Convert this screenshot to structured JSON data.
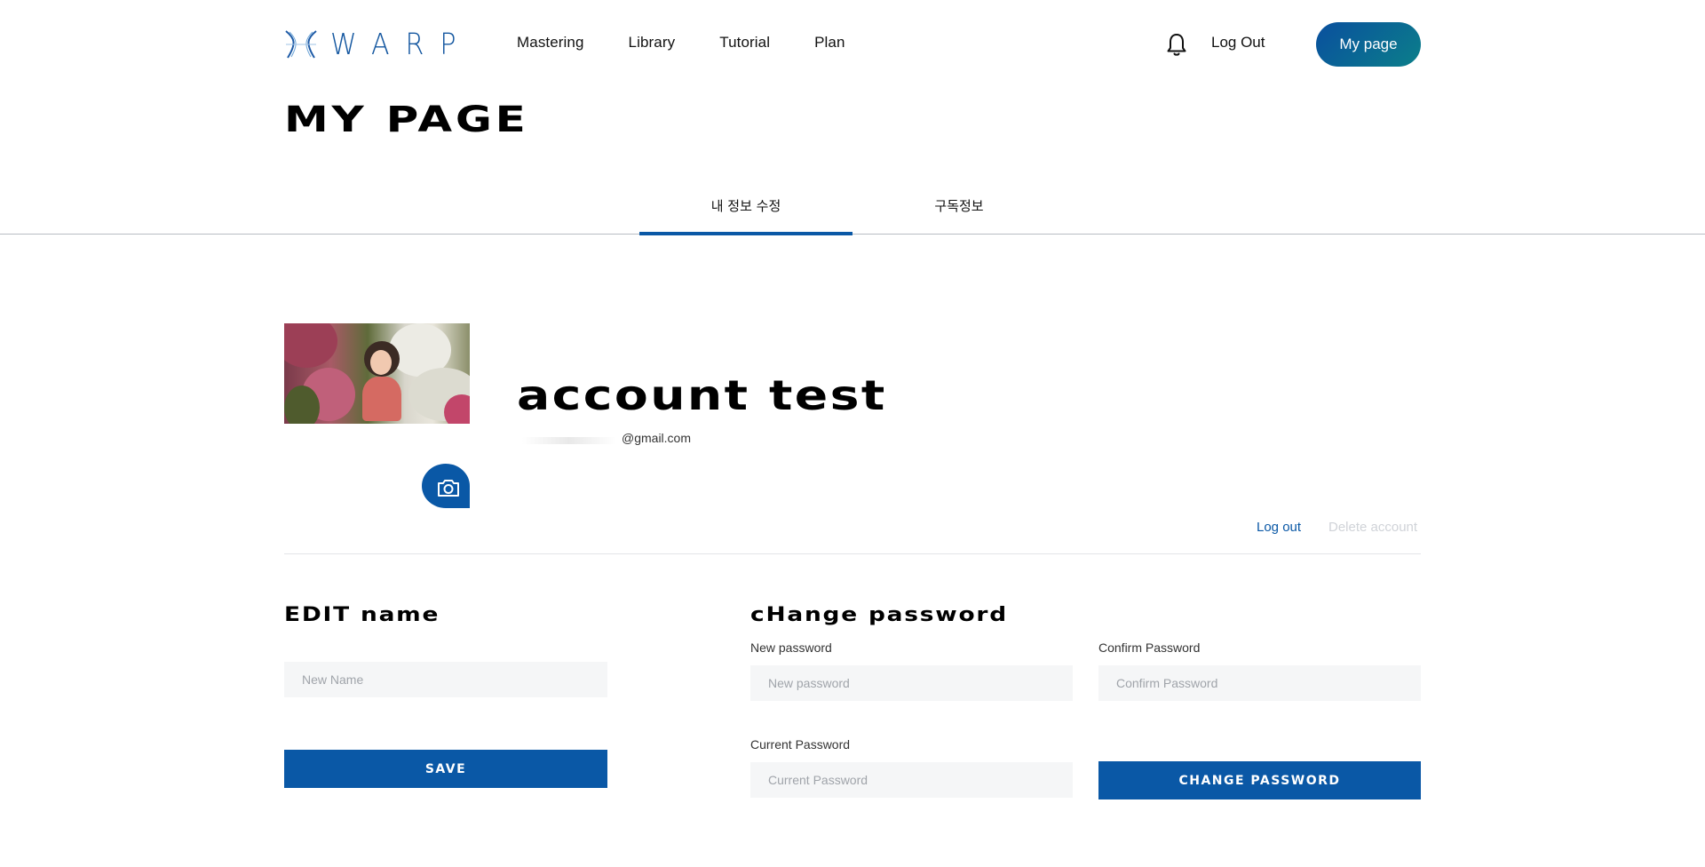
{
  "brand": {
    "name": "WARP",
    "logo_icon": "warp-logo-icon",
    "color": "#1457a0"
  },
  "nav": {
    "items": [
      {
        "label": "Mastering"
      },
      {
        "label": "Library"
      },
      {
        "label": "Tutorial"
      },
      {
        "label": "Plan"
      }
    ],
    "bell_icon": "bell-icon",
    "logout_label": "Log Out",
    "mypage_label": "My page"
  },
  "page": {
    "title": "MY PAGE"
  },
  "tabs": [
    {
      "label": "내 정보 수정",
      "active": true
    },
    {
      "label": "구독정보",
      "active": false
    }
  ],
  "profile": {
    "name": "account test",
    "email": "@gmail.com",
    "camera_icon": "camera-icon",
    "logout_label": "Log out",
    "delete_label": "Delete account"
  },
  "edit_name": {
    "title": "EDIT name",
    "placeholder": "New Name",
    "save_label": "SAVE"
  },
  "change_password": {
    "title": "cHange password",
    "new_label": "New password",
    "new_placeholder": "New password",
    "confirm_label": "Confirm Password",
    "confirm_placeholder": "Confirm Password",
    "current_label": "Current Password",
    "current_placeholder": "Current Password",
    "button_label": "CHANGE PASSWORD"
  },
  "colors": {
    "primary": "#0a58a6",
    "input_bg": "#f5f6f7",
    "muted": "#d0d3d8"
  }
}
